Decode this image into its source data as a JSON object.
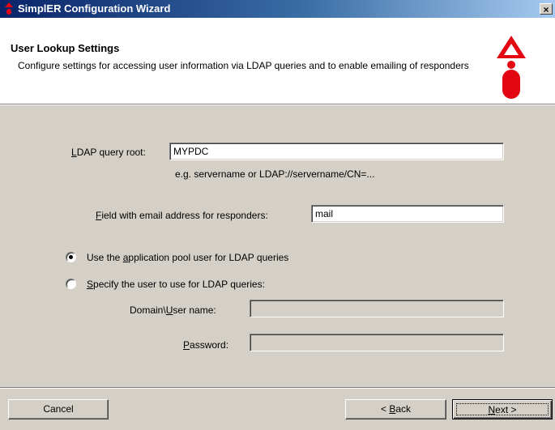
{
  "window": {
    "title": "SimplER Configuration Wizard",
    "close_glyph": "×",
    "icon": "simpler-logo-icon"
  },
  "header": {
    "title": "User Lookup Settings",
    "description": "Configure settings for accessing user information via LDAP queries and to enable emailing of responders",
    "logo": "simpler-logo",
    "logo_color": "#e30613"
  },
  "form": {
    "ldap_root": {
      "label_key": "L",
      "label_rest": "DAP query root:",
      "value": "MYPDC",
      "hint": "e.g. servername or LDAP://servername/CN=..."
    },
    "email_field": {
      "label_key": "F",
      "label_rest": "ield with email address for responders:",
      "value": "mail"
    },
    "radio_app_pool": {
      "label_pre": "Use the ",
      "label_key": "a",
      "label_post": "pplication pool user for LDAP queries",
      "selected": true
    },
    "radio_specify": {
      "label_key": "S",
      "label_post": "pecify the user to use for LDAP queries:",
      "selected": false
    },
    "domain_user": {
      "label_pre": "Domain\\",
      "label_key": "U",
      "label_post": "ser name:",
      "value": ""
    },
    "password": {
      "label_key": "P",
      "label_post": "assword:",
      "value": ""
    }
  },
  "footer": {
    "cancel": "Cancel",
    "back_pre": "< ",
    "back_key": "B",
    "back_post": "ack",
    "next_key": "N",
    "next_post": "ext >"
  }
}
